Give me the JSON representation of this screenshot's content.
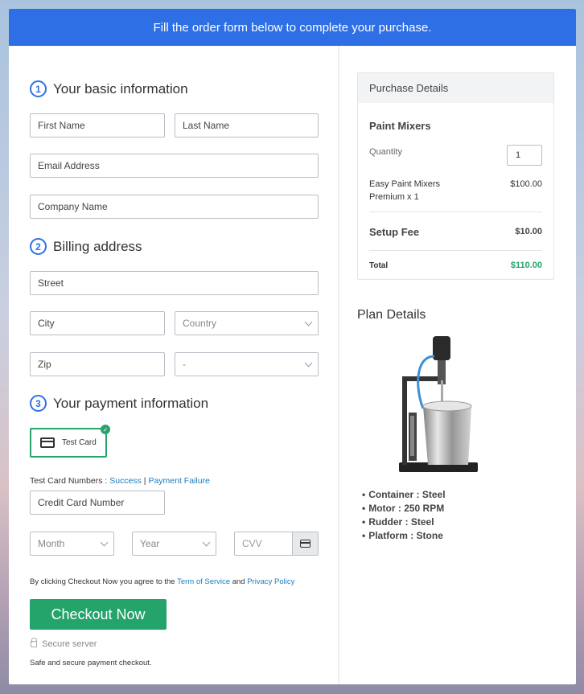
{
  "banner": "Fill the order form below to complete your purchase.",
  "basic": {
    "num": "1",
    "title": "Your basic information",
    "first_name": "First Name",
    "last_name": "Last Name",
    "email": "Email Address",
    "company": "Company Name"
  },
  "billing": {
    "num": "2",
    "title": "Billing address",
    "street": "Street",
    "city": "City",
    "country": "Country",
    "zip": "Zip",
    "state": "-"
  },
  "payment": {
    "num": "3",
    "title": "Your payment information",
    "test_card": "Test Card",
    "test_numbers_label": "Test Card Numbers : ",
    "success": "Success",
    "separator": " | ",
    "failure": "Payment Failure",
    "card_number": "Credit Card Number",
    "month": "Month",
    "year": "Year",
    "cvv": "CVV"
  },
  "terms": {
    "prefix": "By clicking Checkout Now you agree to the ",
    "terms_link": "Term of Service",
    "and": " and ",
    "privacy_link": "Privacy Policy"
  },
  "checkout_label": "Checkout Now",
  "secure_server": "Secure server",
  "safe_text": "Safe and secure payment checkout.",
  "purchase": {
    "header": "Purchase Details",
    "product": "Paint Mixers",
    "quantity_label": "Quantity",
    "quantity_value": "1",
    "item_line1": "Easy Paint Mixers",
    "item_line2": "Premium x 1",
    "item_price": "$100.00",
    "setup_label": "Setup Fee",
    "setup_price": "$10.00",
    "total_label": "Total",
    "total_price": "$110.00"
  },
  "plan": {
    "title": "Plan Details",
    "features": [
      "Container : Steel",
      "Motor : 250 RPM",
      "Rudder : Steel",
      "Platform : Stone"
    ]
  },
  "colors": {
    "accent": "#2f6fe6",
    "button": "#24a36a",
    "total": "#24a36a",
    "link": "#1a7ec2"
  }
}
